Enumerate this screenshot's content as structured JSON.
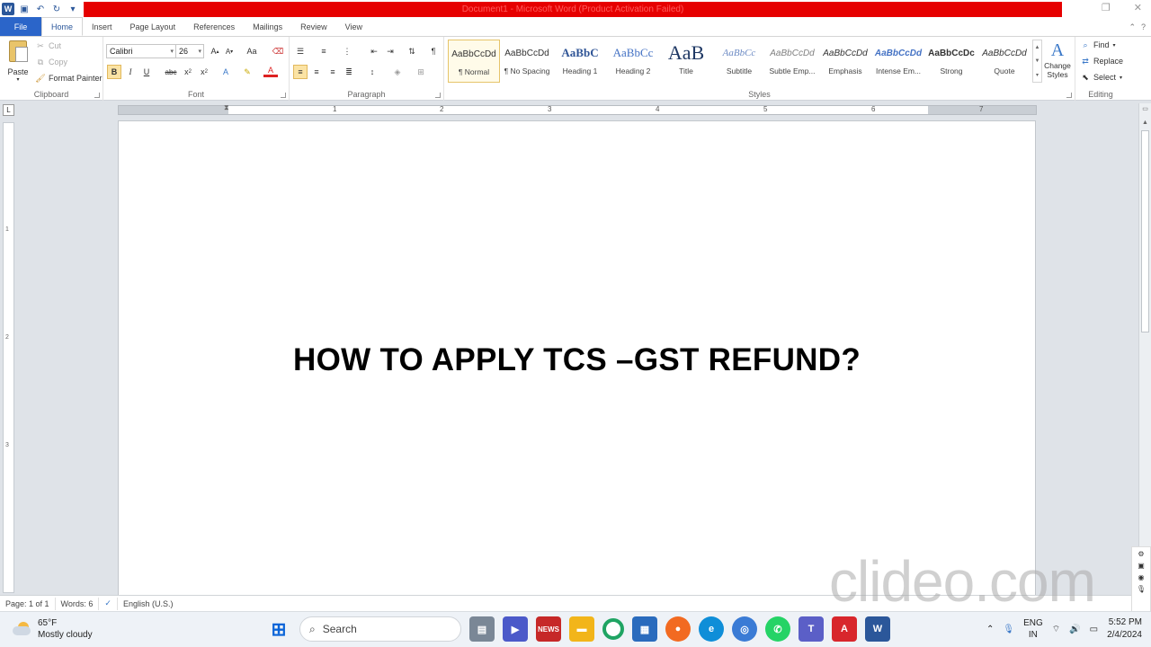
{
  "window": {
    "title": "Document1 - Microsoft Word (Product Activation Failed)",
    "app_icon_letter": "W",
    "title_bar_color": "#e60000"
  },
  "tabs": [
    "File",
    "Home",
    "Insert",
    "Page Layout",
    "References",
    "Mailings",
    "Review",
    "View"
  ],
  "clipboard": {
    "paste": "Paste",
    "cut": "Cut",
    "copy": "Copy",
    "format_painter": "Format Painter",
    "label": "Clipboard"
  },
  "font": {
    "name": "Calibri",
    "size": "26",
    "label": "Font"
  },
  "paragraph": {
    "label": "Paragraph"
  },
  "styles": {
    "label": "Styles",
    "items": [
      {
        "sample": "AaBbCcDd",
        "name": "¶ Normal"
      },
      {
        "sample": "AaBbCcDd",
        "name": "¶ No Spacing"
      },
      {
        "sample": "AaBbC",
        "name": "Heading 1"
      },
      {
        "sample": "AaBbCc",
        "name": "Heading 2"
      },
      {
        "sample": "AaB",
        "name": "Title"
      },
      {
        "sample": "AaBbCc",
        "name": "Subtitle"
      },
      {
        "sample": "AaBbCcDd",
        "name": "Subtle Emp..."
      },
      {
        "sample": "AaBbCcDd",
        "name": "Emphasis"
      },
      {
        "sample": "AaBbCcDd",
        "name": "Intense Em..."
      },
      {
        "sample": "AaBbCcDc",
        "name": "Strong"
      },
      {
        "sample": "AaBbCcDd",
        "name": "Quote"
      }
    ],
    "change_styles": "Change Styles"
  },
  "editing": {
    "find": "Find",
    "replace": "Replace",
    "select": "Select",
    "label": "Editing"
  },
  "ruler_numbers": [
    "1",
    "2",
    "3",
    "4",
    "5",
    "6",
    "7"
  ],
  "vruler_numbers": [
    "1",
    "2",
    "3"
  ],
  "document": {
    "heading": "HOW TO APPLY TCS –GST REFUND?"
  },
  "status": {
    "page": "Page: 1 of 1",
    "words": "Words: 6",
    "language": "English (U.S.)"
  },
  "watermark": "clideo.com",
  "taskbar": {
    "temperature": "65°F",
    "weather": "Mostly cloudy",
    "search_placeholder": "Search",
    "lang_top": "ENG",
    "lang_bottom": "IN",
    "time": "5:52 PM",
    "date": "2/4/2024"
  }
}
